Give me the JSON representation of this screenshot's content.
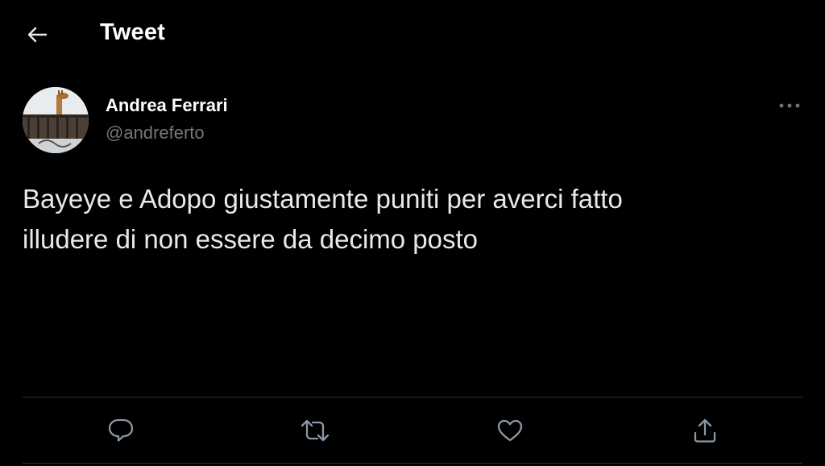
{
  "header": {
    "title": "Tweet",
    "back_icon": "arrow-left-icon"
  },
  "tweet": {
    "author": {
      "name": "Andrea Ferrari",
      "handle": "@andreferto",
      "avatar": "giraffe-photo"
    },
    "more_icon": "more-horizontal-icon",
    "text_lines": [
      "Bayeye e Adopo giustamente puniti per averci fatto",
      "illudere di non essere da decimo posto"
    ]
  },
  "actions": [
    {
      "name": "reply",
      "icon": "reply-bubble-icon"
    },
    {
      "name": "retweet",
      "icon": "retweet-icon"
    },
    {
      "name": "like",
      "icon": "heart-icon"
    },
    {
      "name": "share",
      "icon": "share-icon"
    }
  ],
  "colors": {
    "background": "#000000",
    "text_primary": "#e7e9ea",
    "text_secondary": "#71767b",
    "divider": "#2f3336"
  }
}
